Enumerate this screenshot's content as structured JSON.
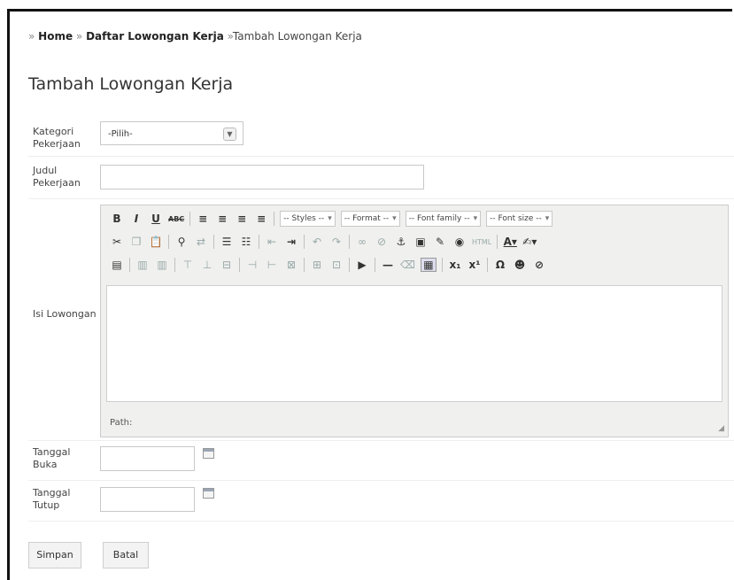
{
  "breadcrumb": {
    "prefix": "» ",
    "home": "Home",
    "sep1": " » ",
    "list": "Daftar Lowongan Kerja",
    "sep2": " »",
    "current": "Tambah Lowongan Kerja"
  },
  "page_title": "Tambah Lowongan Kerja",
  "form": {
    "kategori_label": "Kategori Pekerjaan",
    "kategori_value": "-Pilih-",
    "judul_label": "Judul Pekerjaan",
    "judul_value": "",
    "isi_label": "Isi Lowongan",
    "tanggal_buka_label": "Tanggal Buka",
    "tanggal_buka_value": "",
    "tanggal_tutup_label": "Tanggal Tutup",
    "tanggal_tutup_value": ""
  },
  "editor": {
    "toolbar1": {
      "bold": "B",
      "italic": "I",
      "underline": "U",
      "strike": "ABC",
      "styles": "-- Styles --",
      "format": "-- Format --",
      "font_family": "-- Font family --",
      "font_size": "-- Font size --"
    },
    "path_label": "Path:"
  },
  "buttons": {
    "save": "Simpan",
    "cancel": "Batal"
  }
}
